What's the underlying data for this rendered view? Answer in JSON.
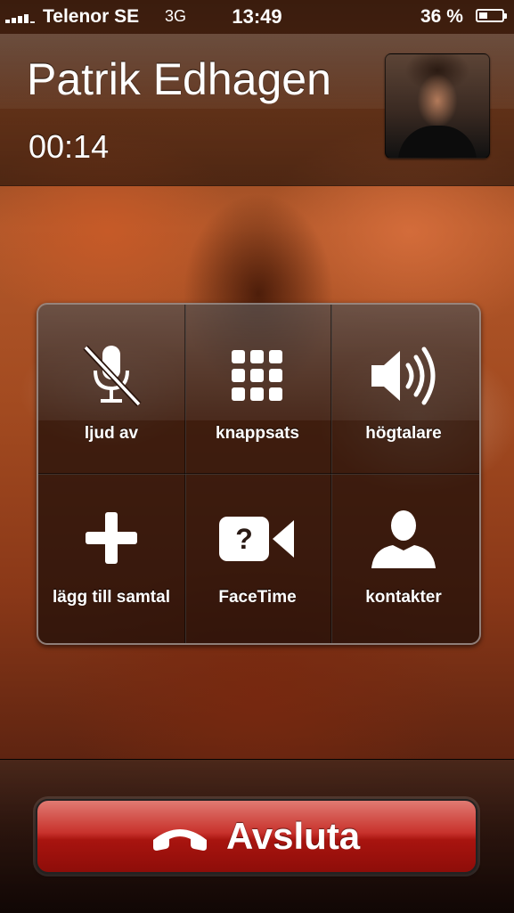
{
  "status_bar": {
    "carrier": "Telenor SE",
    "network": "3G",
    "time": "13:49",
    "battery_percent": "36 %",
    "battery_level": 0.36
  },
  "caller": {
    "name": "Patrik Edhagen",
    "duration": "00:14"
  },
  "call_options": [
    {
      "label": "ljud av",
      "icon": "mute-microphone-icon"
    },
    {
      "label": "knappsats",
      "icon": "keypad-icon"
    },
    {
      "label": "högtalare",
      "icon": "speaker-icon"
    },
    {
      "label": "lägg till samtal",
      "icon": "plus-icon"
    },
    {
      "label": "FaceTime",
      "icon": "facetime-camera-icon"
    },
    {
      "label": "kontakter",
      "icon": "contact-person-icon"
    }
  ],
  "end_call": {
    "label": "Avsluta",
    "icon": "handset-icon",
    "color": "#c8322c"
  }
}
